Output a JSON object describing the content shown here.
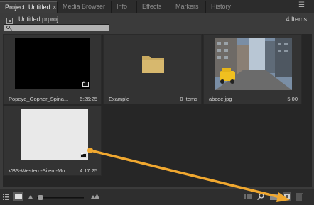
{
  "tabs": [
    {
      "label": "Project: Untitled",
      "active": true,
      "close": "×"
    },
    {
      "label": "Media Browser"
    },
    {
      "label": "Info"
    },
    {
      "label": "Effects"
    },
    {
      "label": "Markers"
    },
    {
      "label": "History"
    }
  ],
  "panel": {
    "project_file": "Untitled.prproj",
    "item_count": "4 Items",
    "search_placeholder": ""
  },
  "items": [
    {
      "name": "Popeye_Gopher_Spina...",
      "meta": "6:26:25",
      "kind": "video"
    },
    {
      "name": "Example",
      "meta": "0 Items",
      "kind": "bin"
    },
    {
      "name": "abcde.jpg",
      "meta": "5;00",
      "kind": "image"
    },
    {
      "name": "VBS-Western-Silent-Mo...",
      "meta": "4:17:25",
      "kind": "video"
    }
  ],
  "bottombar": {
    "zoom_level": 0.05
  },
  "colors": {
    "annotation_arrow": "#f0a830",
    "folder": "#d2b36a"
  }
}
